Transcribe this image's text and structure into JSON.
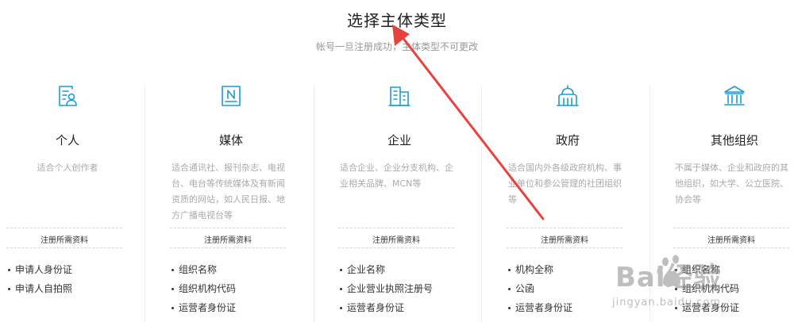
{
  "header": {
    "title": "选择主体类型",
    "subtitle": "帐号一旦注册成功，主体类型不可更改"
  },
  "colors": {
    "accent": "#1a9bd7",
    "annotation": "#e8423f"
  },
  "cards": [
    {
      "icon": "person-document-icon",
      "title": "个人",
      "desc": "适合个人创作者",
      "req_label": "注册所需资料",
      "requirements": [
        "申请人身份证",
        "申请人自拍照"
      ]
    },
    {
      "icon": "newspaper-icon",
      "title": "媒体",
      "desc": "适合通讯社、报刊杂志、电视台、电台等传统媒体及有新闻资质的网站，如人民日报、地方广播电视台等",
      "req_label": "注册所需资料",
      "requirements": [
        "组织名称",
        "组织机构代码",
        "运营者身份证"
      ]
    },
    {
      "icon": "building-icon",
      "title": "企业",
      "desc": "适合企业、企业分支机构、企业相关品牌、MCN等",
      "req_label": "注册所需资料",
      "requirements": [
        "企业名称",
        "企业营业执照注册号",
        "运营者身份证"
      ]
    },
    {
      "icon": "capitol-icon",
      "title": "政府",
      "desc": "适合国内外各级政府机构、事业单位和参公管理的社团组织等",
      "req_label": "注册所需资料",
      "requirements": [
        "机构全称",
        "公函",
        "运营者身份证"
      ]
    },
    {
      "icon": "institution-icon",
      "title": "其他组织",
      "desc": "不属于媒体、企业和政府的其他组织，如大学、公立医院、协会等",
      "req_label": "注册所需资料",
      "requirements": [
        "组织名称",
        "组织机构代码",
        "运营者身份证"
      ]
    }
  ],
  "watermark": {
    "text": "Bai经验",
    "url": "jingyan.baidu.com"
  }
}
